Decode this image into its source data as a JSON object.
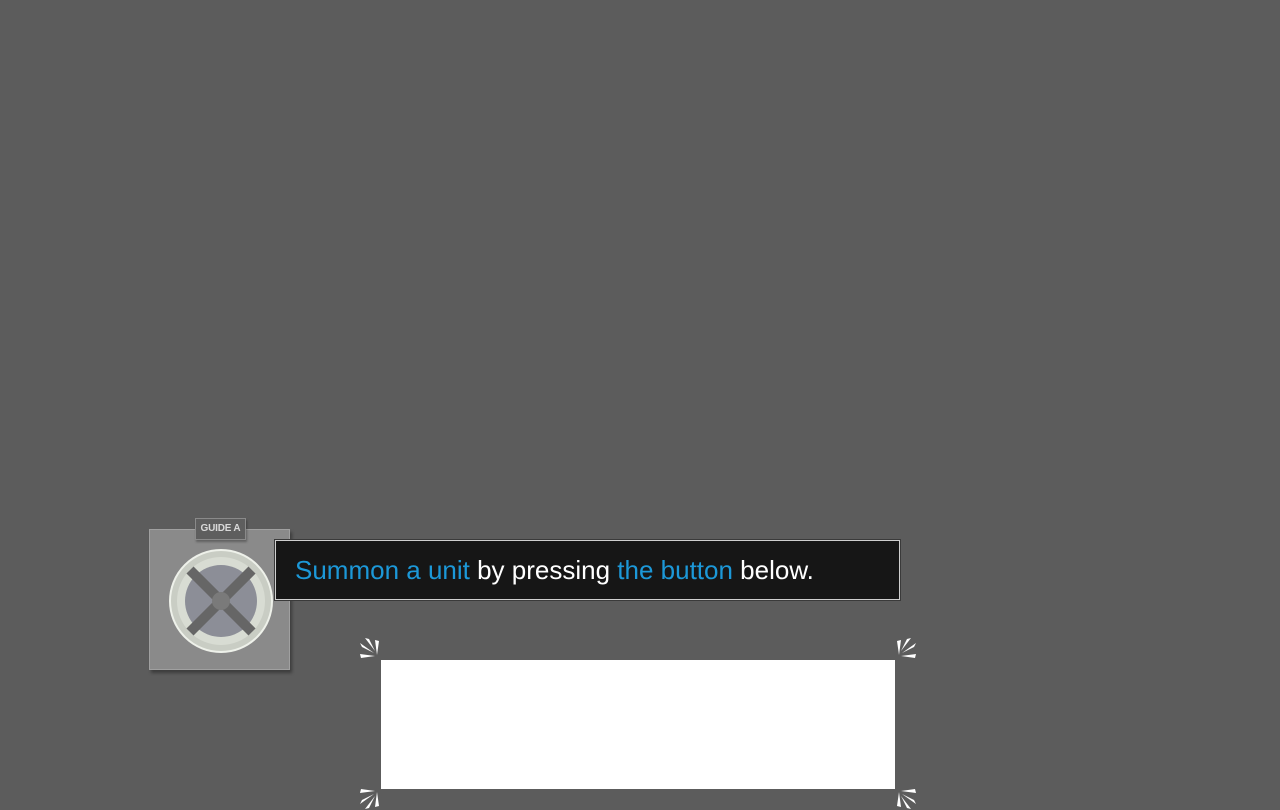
{
  "guide": {
    "label": "GUIDE A",
    "icon": "crossed-circle-icon"
  },
  "dialog": {
    "segments": [
      {
        "text": "Summon a unit",
        "highlight": true
      },
      {
        "text": " by pressing ",
        "highlight": false
      },
      {
        "text": "the button",
        "highlight": true
      },
      {
        "text": " below.",
        "highlight": false
      }
    ]
  },
  "colors": {
    "background": "#5c5c5c",
    "highlight": "#1c98d8",
    "dialog_bg": "#161616"
  }
}
